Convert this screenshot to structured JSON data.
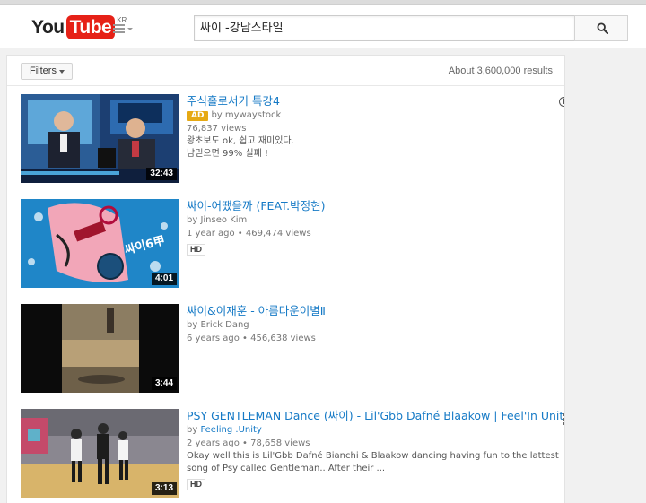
{
  "header": {
    "logo_you": "You",
    "logo_tube": "Tube",
    "logo_region": "KR",
    "search_value": "싸이 -강남스타일"
  },
  "toolbar": {
    "filters_label": "Filters",
    "results_count": "About 3,600,000 results"
  },
  "results": [
    {
      "title": "주식홀로서기 특강4",
      "ad_label": "AD",
      "by_prefix": "by ",
      "channel": "mywaystock",
      "views": "76,837 views",
      "desc_lines": [
        "왕초보도 ok, 쉽고 재미있다.",
        "남믿으면 99% 실패 !"
      ],
      "duration": "32:43",
      "colors": {
        "base": "#1c3f72",
        "accent": "#4aa3d8"
      }
    },
    {
      "title": "싸이-어땠을까 (FEAT.박정현)",
      "by_prefix": "by ",
      "channel": "Jinseo Kim",
      "age": "1 year ago",
      "views": "469,474 views",
      "hd": "HD",
      "duration": "4:01",
      "colors": {
        "base": "#1f86c8",
        "accent": "#f2a6b8"
      }
    },
    {
      "title": "싸이&이재훈 - 아름다운이별Ⅱ",
      "by_prefix": "by ",
      "channel": "Erick Dang",
      "age": "6 years ago",
      "views": "456,638 views",
      "duration": "3:44",
      "colors": {
        "base": "#0b0b0b",
        "accent": "#b8a077"
      }
    },
    {
      "title": "PSY GENTLEMAN Dance (싸이) - Lil'Gbb Dafné Blaakow | Feel'In Unity",
      "by_prefix": "by ",
      "channel": "Feeling .Unity",
      "age": "2 years ago",
      "views": "78,658 views",
      "desc_lines": [
        "Okay well this is Lil'Gbb Dafné Bianchi & Blaakow dancing having fun to the lattest",
        "song of Psy called Gentleman.. After their ..."
      ],
      "hd": "HD",
      "duration": "3:13",
      "colors": {
        "base": "#8a8790",
        "accent": "#d8b46a"
      }
    }
  ]
}
